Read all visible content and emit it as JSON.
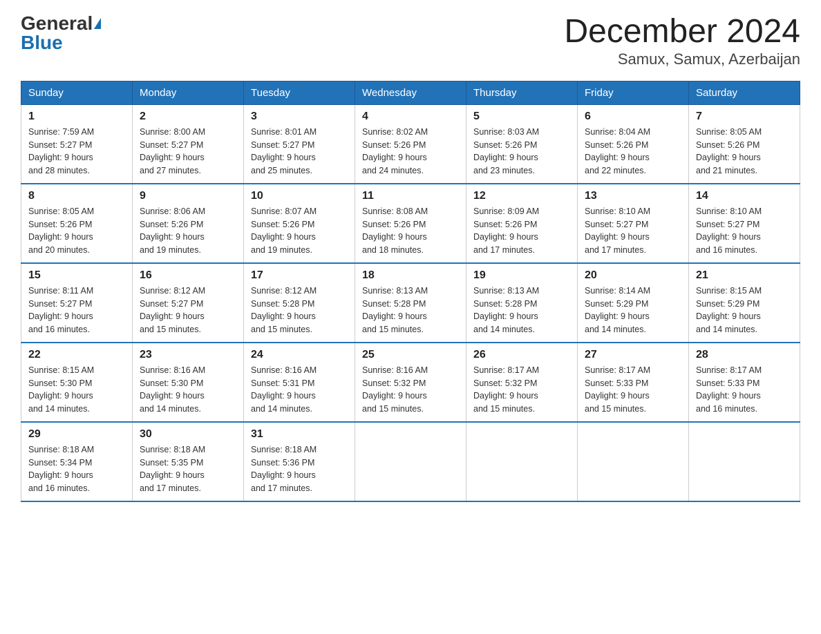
{
  "logo": {
    "general": "General",
    "blue": "Blue"
  },
  "title": "December 2024",
  "subtitle": "Samux, Samux, Azerbaijan",
  "headers": [
    "Sunday",
    "Monday",
    "Tuesday",
    "Wednesday",
    "Thursday",
    "Friday",
    "Saturday"
  ],
  "weeks": [
    [
      {
        "day": "1",
        "sunrise": "7:59 AM",
        "sunset": "5:27 PM",
        "daylight": "9 hours and 28 minutes."
      },
      {
        "day": "2",
        "sunrise": "8:00 AM",
        "sunset": "5:27 PM",
        "daylight": "9 hours and 27 minutes."
      },
      {
        "day": "3",
        "sunrise": "8:01 AM",
        "sunset": "5:27 PM",
        "daylight": "9 hours and 25 minutes."
      },
      {
        "day": "4",
        "sunrise": "8:02 AM",
        "sunset": "5:26 PM",
        "daylight": "9 hours and 24 minutes."
      },
      {
        "day": "5",
        "sunrise": "8:03 AM",
        "sunset": "5:26 PM",
        "daylight": "9 hours and 23 minutes."
      },
      {
        "day": "6",
        "sunrise": "8:04 AM",
        "sunset": "5:26 PM",
        "daylight": "9 hours and 22 minutes."
      },
      {
        "day": "7",
        "sunrise": "8:05 AM",
        "sunset": "5:26 PM",
        "daylight": "9 hours and 21 minutes."
      }
    ],
    [
      {
        "day": "8",
        "sunrise": "8:05 AM",
        "sunset": "5:26 PM",
        "daylight": "9 hours and 20 minutes."
      },
      {
        "day": "9",
        "sunrise": "8:06 AM",
        "sunset": "5:26 PM",
        "daylight": "9 hours and 19 minutes."
      },
      {
        "day": "10",
        "sunrise": "8:07 AM",
        "sunset": "5:26 PM",
        "daylight": "9 hours and 19 minutes."
      },
      {
        "day": "11",
        "sunrise": "8:08 AM",
        "sunset": "5:26 PM",
        "daylight": "9 hours and 18 minutes."
      },
      {
        "day": "12",
        "sunrise": "8:09 AM",
        "sunset": "5:26 PM",
        "daylight": "9 hours and 17 minutes."
      },
      {
        "day": "13",
        "sunrise": "8:10 AM",
        "sunset": "5:27 PM",
        "daylight": "9 hours and 17 minutes."
      },
      {
        "day": "14",
        "sunrise": "8:10 AM",
        "sunset": "5:27 PM",
        "daylight": "9 hours and 16 minutes."
      }
    ],
    [
      {
        "day": "15",
        "sunrise": "8:11 AM",
        "sunset": "5:27 PM",
        "daylight": "9 hours and 16 minutes."
      },
      {
        "day": "16",
        "sunrise": "8:12 AM",
        "sunset": "5:27 PM",
        "daylight": "9 hours and 15 minutes."
      },
      {
        "day": "17",
        "sunrise": "8:12 AM",
        "sunset": "5:28 PM",
        "daylight": "9 hours and 15 minutes."
      },
      {
        "day": "18",
        "sunrise": "8:13 AM",
        "sunset": "5:28 PM",
        "daylight": "9 hours and 15 minutes."
      },
      {
        "day": "19",
        "sunrise": "8:13 AM",
        "sunset": "5:28 PM",
        "daylight": "9 hours and 14 minutes."
      },
      {
        "day": "20",
        "sunrise": "8:14 AM",
        "sunset": "5:29 PM",
        "daylight": "9 hours and 14 minutes."
      },
      {
        "day": "21",
        "sunrise": "8:15 AM",
        "sunset": "5:29 PM",
        "daylight": "9 hours and 14 minutes."
      }
    ],
    [
      {
        "day": "22",
        "sunrise": "8:15 AM",
        "sunset": "5:30 PM",
        "daylight": "9 hours and 14 minutes."
      },
      {
        "day": "23",
        "sunrise": "8:16 AM",
        "sunset": "5:30 PM",
        "daylight": "9 hours and 14 minutes."
      },
      {
        "day": "24",
        "sunrise": "8:16 AM",
        "sunset": "5:31 PM",
        "daylight": "9 hours and 14 minutes."
      },
      {
        "day": "25",
        "sunrise": "8:16 AM",
        "sunset": "5:32 PM",
        "daylight": "9 hours and 15 minutes."
      },
      {
        "day": "26",
        "sunrise": "8:17 AM",
        "sunset": "5:32 PM",
        "daylight": "9 hours and 15 minutes."
      },
      {
        "day": "27",
        "sunrise": "8:17 AM",
        "sunset": "5:33 PM",
        "daylight": "9 hours and 15 minutes."
      },
      {
        "day": "28",
        "sunrise": "8:17 AM",
        "sunset": "5:33 PM",
        "daylight": "9 hours and 16 minutes."
      }
    ],
    [
      {
        "day": "29",
        "sunrise": "8:18 AM",
        "sunset": "5:34 PM",
        "daylight": "9 hours and 16 minutes."
      },
      {
        "day": "30",
        "sunrise": "8:18 AM",
        "sunset": "5:35 PM",
        "daylight": "9 hours and 17 minutes."
      },
      {
        "day": "31",
        "sunrise": "8:18 AM",
        "sunset": "5:36 PM",
        "daylight": "9 hours and 17 minutes."
      },
      null,
      null,
      null,
      null
    ]
  ],
  "labels": {
    "sunrise": "Sunrise:",
    "sunset": "Sunset:",
    "daylight": "Daylight:"
  }
}
